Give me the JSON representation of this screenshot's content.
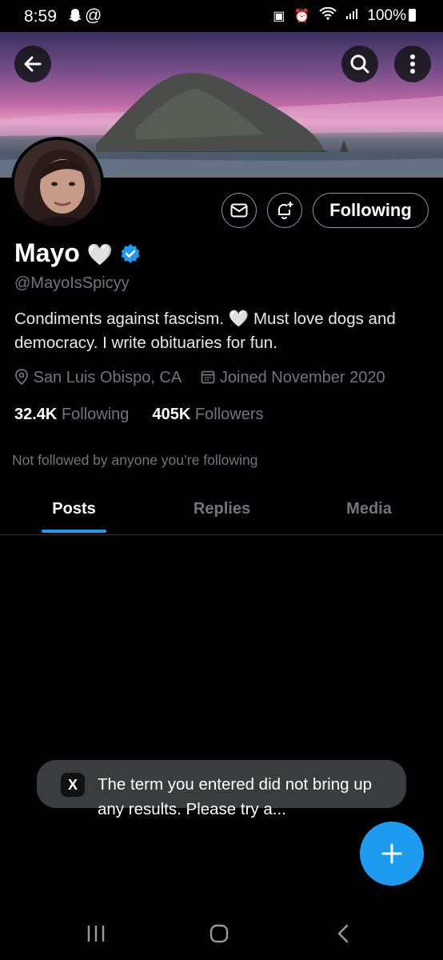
{
  "status_bar": {
    "time": "8:59",
    "left_icons": [
      "snapchat-icon",
      "at-sign-icon"
    ],
    "at_glyph": "@",
    "right_icons": [
      "nfc-icon",
      "alarm-icon",
      "wifi-icon",
      "signal-icon",
      "battery-icon"
    ],
    "battery": "100%"
  },
  "header": {
    "back_icon": "back-arrow-icon",
    "search_icon": "search-icon",
    "more_icon": "more-options-icon"
  },
  "actions": {
    "message_icon": "envelope-icon",
    "notify_icon": "bell-plus-icon",
    "following_label": "Following"
  },
  "profile": {
    "name": "Mayo",
    "name_emoji": "🤍",
    "verified_icon": "verified-badge-icon",
    "handle": "@MayoIsSpicyy",
    "bio": "Condiments against fascism. 🤍 Must love dogs and democracy. I write obituaries for fun.",
    "location": "San Luis Obispo, CA",
    "joined": "Joined November 2020",
    "following_count": "32.4K",
    "following_label": "Following",
    "followers_count": "405K",
    "followers_label": "Followers",
    "followed_note": "Not followed by anyone you’re following"
  },
  "tabs": [
    {
      "label": "Posts",
      "active": true
    },
    {
      "label": "Replies",
      "active": false
    },
    {
      "label": "Media",
      "active": false
    }
  ],
  "toast": {
    "icon": "x-logo-icon",
    "logo_text": "X",
    "message": "The term you entered did not bring up any results. Please try a..."
  },
  "fab": {
    "icon": "plus-icon"
  },
  "nav_bar": {
    "icons": [
      "recent-apps-icon",
      "home-icon",
      "back-icon"
    ]
  },
  "colors": {
    "accent": "#1d9bf0",
    "background": "#000000",
    "secondary_text": "#71767b"
  }
}
